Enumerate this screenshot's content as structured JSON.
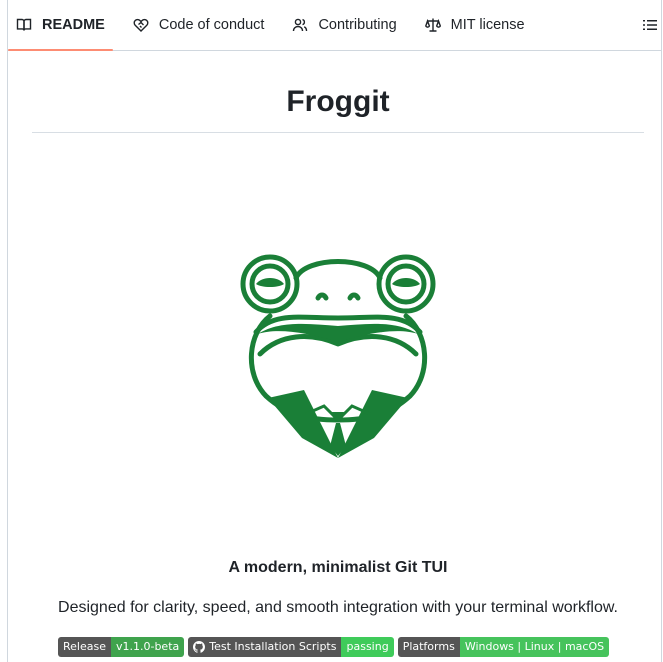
{
  "tabs": [
    {
      "label": "README",
      "icon": "book-icon",
      "active": true
    },
    {
      "label": "Code of conduct",
      "icon": "heart-handshake-icon",
      "active": false
    },
    {
      "label": "Contributing",
      "icon": "people-icon",
      "active": false
    },
    {
      "label": "MIT license",
      "icon": "law-scale-icon",
      "active": false
    }
  ],
  "outline_icon": "list-outline-icon",
  "readme": {
    "title": "Froggit",
    "logo_icon": "frog-logo",
    "tagline": "A modern, minimalist Git TUI",
    "description": "Designed for clarity, speed, and smooth integration with your terminal workflow."
  },
  "badges": [
    {
      "label": "Release",
      "value": "v1.1.0-beta",
      "color": "#3fa34d"
    },
    {
      "label": "Test Installation Scripts",
      "value": "passing",
      "icon": "github-icon",
      "color": "#3fcb5a"
    },
    {
      "label": "Platforms",
      "value": "Windows | Linux | macOS",
      "color": "#46c35c"
    }
  ],
  "colors": {
    "accent": "#fd8c73",
    "frog_green": "#1a7f37",
    "border": "#d0d7de"
  }
}
